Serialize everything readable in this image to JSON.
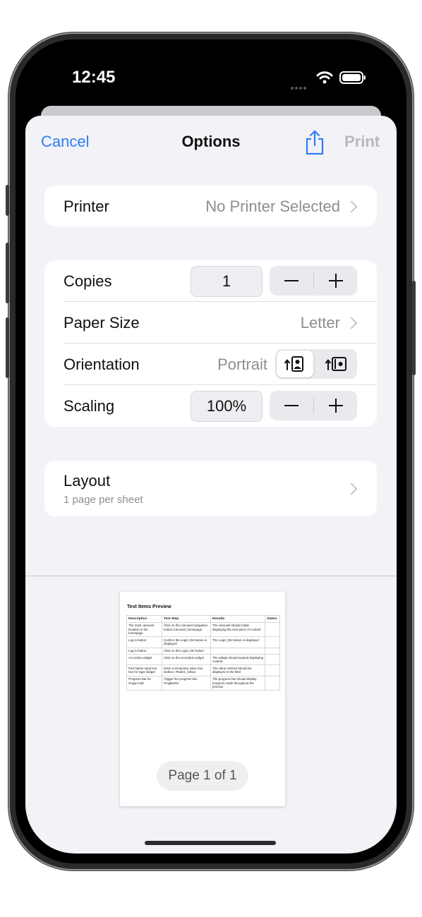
{
  "status_bar": {
    "time": "12:45"
  },
  "nav": {
    "cancel": "Cancel",
    "title": "Options",
    "print": "Print"
  },
  "printer": {
    "label": "Printer",
    "value": "No Printer Selected"
  },
  "copies": {
    "label": "Copies",
    "value": "1"
  },
  "paper_size": {
    "label": "Paper Size",
    "value": "Letter"
  },
  "orientation": {
    "label": "Orientation",
    "value": "Portrait",
    "selected": "portrait"
  },
  "scaling": {
    "label": "Scaling",
    "value": "100%"
  },
  "layout": {
    "label": "Layout",
    "sublabel": "1 page per sheet"
  },
  "preview": {
    "title": "Test Items Preview",
    "columns": [
      "Description",
      "Test Step",
      "Results",
      "Status"
    ],
    "rows": [
      [
        "The main carousel located on the homepage",
        "Click on the carousel navigation button Carousel_homepage",
        "The carousel should rotate displaying the next piece of content",
        ""
      ],
      [
        "Log in button",
        "Confirm the Login_btn button is displayed",
        "The Login_btn button is displayed",
        ""
      ],
      [
        "Log in button",
        "Click on the Login_btn button",
        "",
        ""
      ],
      [
        "Accordion widget",
        "Click on the accordion widget",
        "The widget should expand displaying content.",
        ""
      ],
      [
        "First Name input text box for login widget",
        "Enter a temporary value into textbox: FName_txtbox",
        "The value entered should be displayed in the field",
        ""
      ],
      [
        "Progress Bar for image load",
        "Trigger the progress bar: ProgBar03",
        "The progress bar should display progress made throughout the process",
        ""
      ]
    ],
    "page_indicator": "Page 1 of 1"
  },
  "colors": {
    "accent": "#2f7ff0",
    "disabled": "#b8b8bd",
    "background": "#f2f2f7"
  },
  "icons": [
    "share-icon",
    "chevron-right-icon",
    "minus-icon",
    "plus-icon",
    "portrait-orientation-icon",
    "landscape-orientation-icon",
    "wifi-icon",
    "battery-icon"
  ]
}
